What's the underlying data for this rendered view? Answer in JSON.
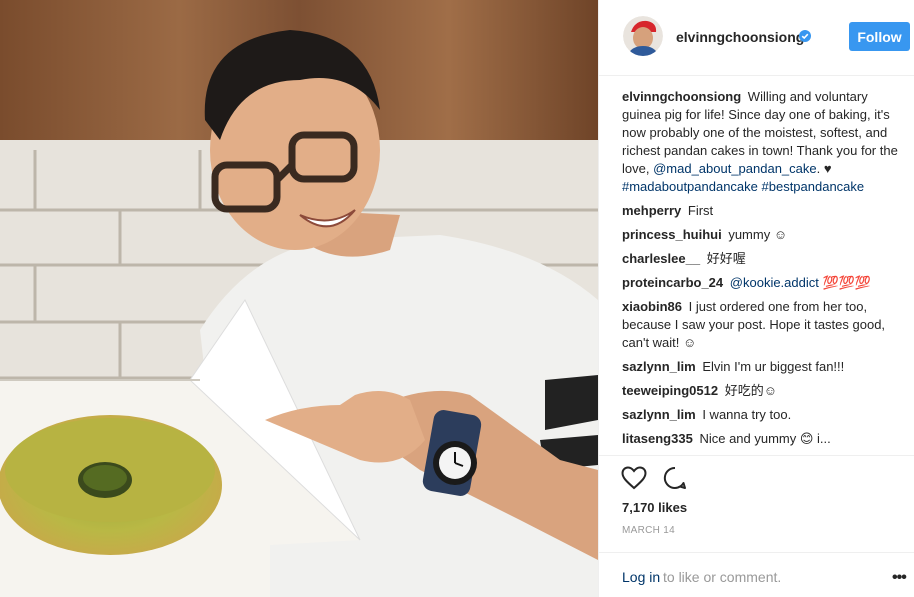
{
  "post": {
    "username": "elvinngchoonsiong",
    "follow_label": "Follow",
    "caption": {
      "username": "elvinngchoonsiong",
      "text": "Willing and voluntary guinea pig for life! Since day one of baking, it's now probably one of the moistest, softest, and richest pandan cakes in town! Thank you for the love, ",
      "mention": "@mad_about_pandan_cake",
      "after_mention": ". ♥",
      "hashtags": "#madaboutpandancake #bestpandancake"
    },
    "comments": [
      {
        "user": "mehperry",
        "text": "First"
      },
      {
        "user": "princess_huihui",
        "text": "yummy ☺"
      },
      {
        "user": "charleslee__",
        "text": "好好喔"
      },
      {
        "user": "proteincarbo_24",
        "mention": "@kookie.addict",
        "text": " 💯💯💯"
      },
      {
        "user": "xiaobin86",
        "text": "I just ordered one from her too, because I saw your post. Hope it tastes good, can't wait! ☺"
      },
      {
        "user": "sazlynn_lim",
        "text": "Elvin I'm ur biggest fan!!!"
      },
      {
        "user": "teeweiping0512",
        "text": "好吃的☺"
      },
      {
        "user": "sazlynn_lim",
        "text": "I wanna try too."
      },
      {
        "user": "litaseng335",
        "text": "Nice and yummy 😊 i..."
      }
    ],
    "likes": "7,170 likes",
    "date": "MARCH 14",
    "login_link": "Log in",
    "login_rest": "to like or comment.",
    "more": "•••",
    "icons": {
      "heart": "heart-icon",
      "comment": "comment-icon",
      "verified": "verified-badge-icon"
    },
    "colors": {
      "follow_button": "#3897f0",
      "link": "#003569",
      "muted": "#999999"
    }
  }
}
